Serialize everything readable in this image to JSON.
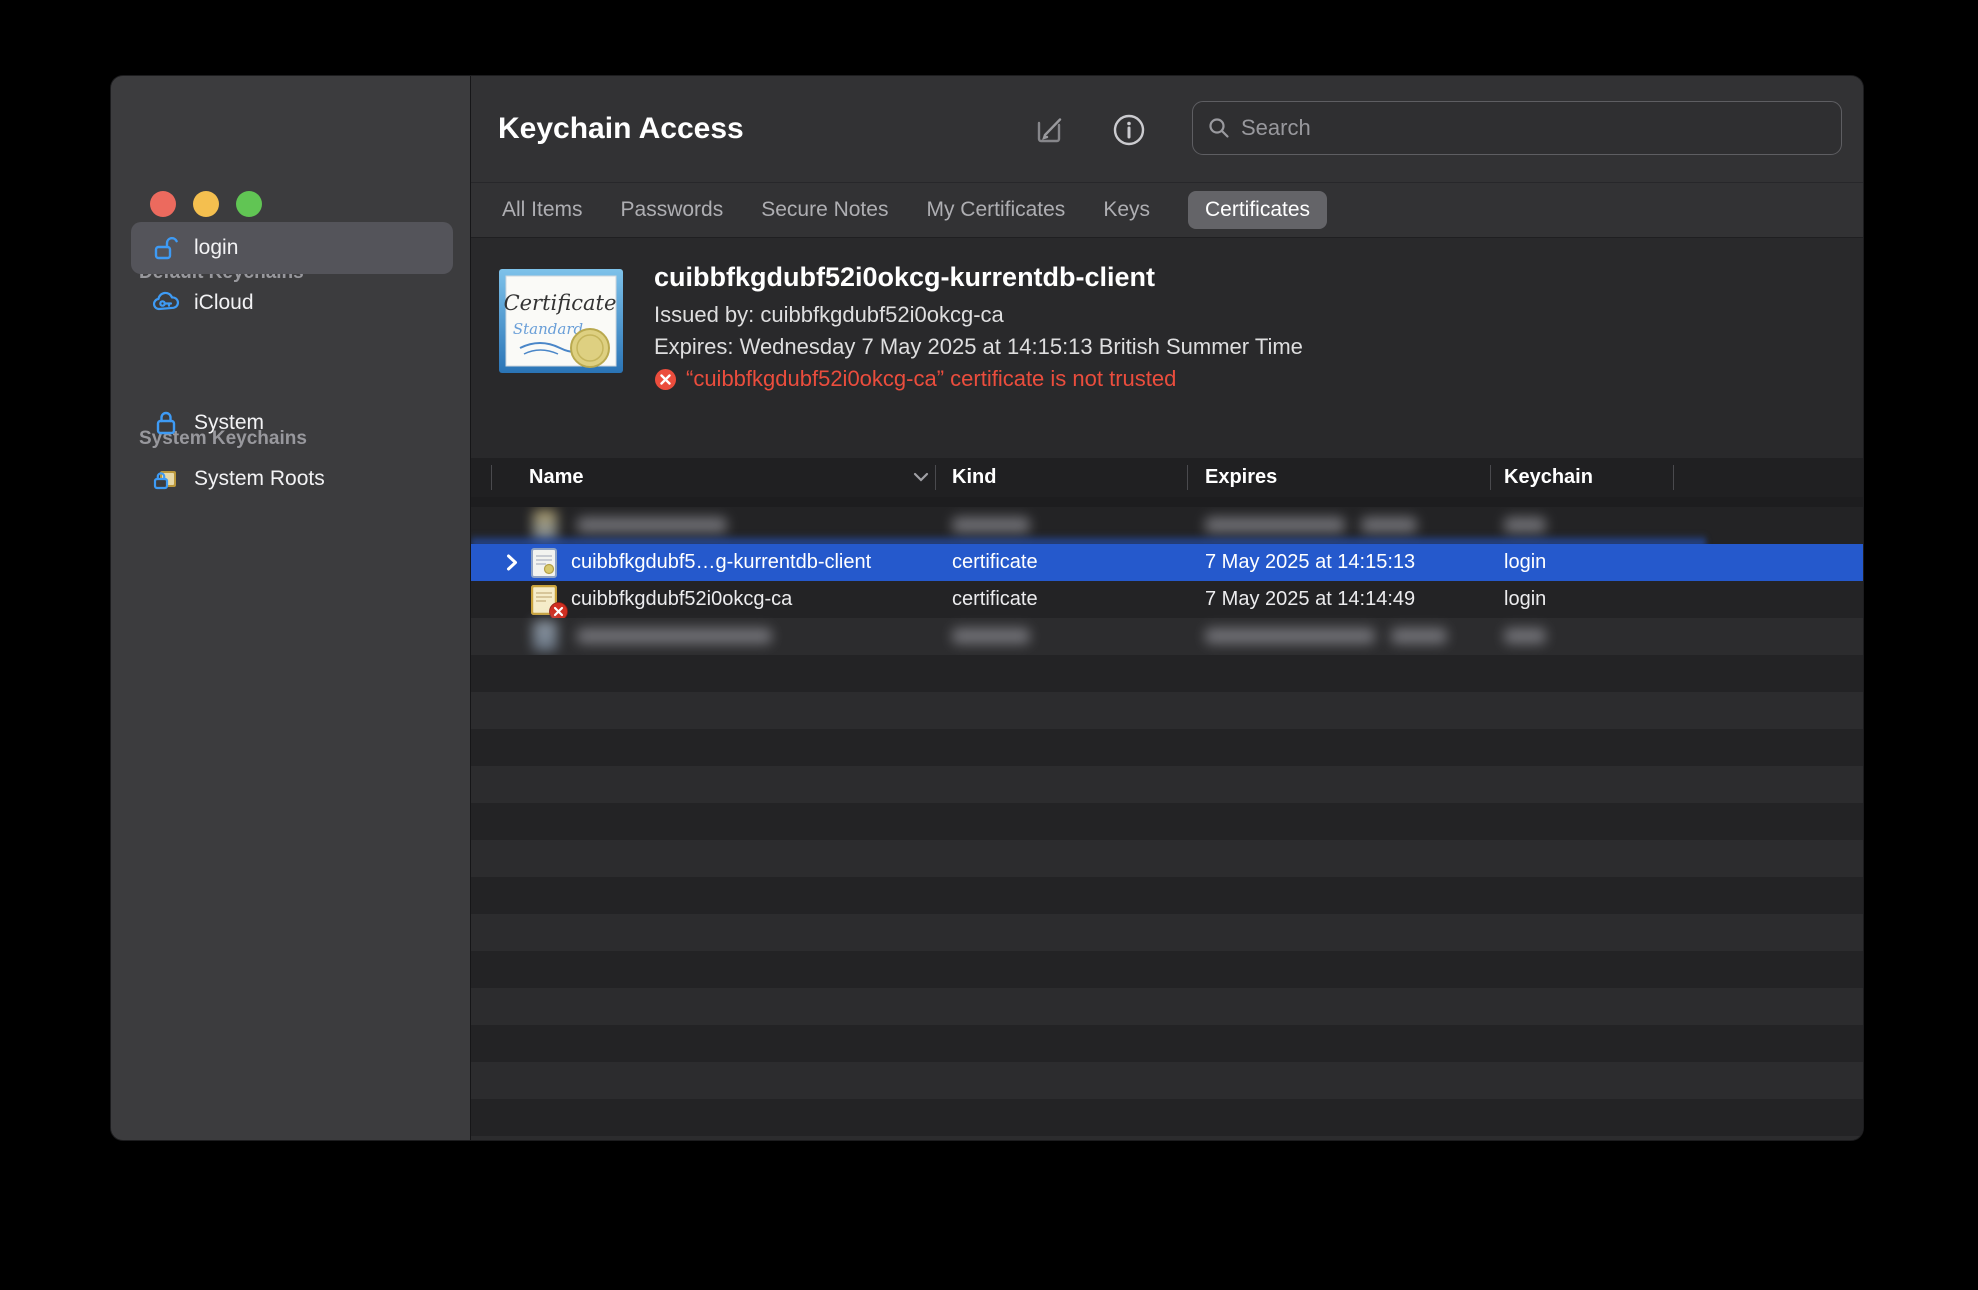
{
  "window_title": "Keychain Access",
  "sidebar": {
    "sections": [
      {
        "label": "Default Keychains",
        "items": [
          {
            "label": "login"
          },
          {
            "label": "iCloud"
          }
        ]
      },
      {
        "label": "System Keychains",
        "items": [
          {
            "label": "System"
          },
          {
            "label": "System Roots"
          }
        ]
      }
    ]
  },
  "toolbar": {
    "search_placeholder": "Search"
  },
  "tabs": {
    "items": [
      {
        "label": "All Items"
      },
      {
        "label": "Passwords"
      },
      {
        "label": "Secure Notes"
      },
      {
        "label": "My Certificates"
      },
      {
        "label": "Keys"
      },
      {
        "label": "Certificates"
      }
    ],
    "selected": "Certificates"
  },
  "detail": {
    "name": "cuibbfkgdubf52i0okcg-kurrentdb-client",
    "issued_by": "Issued by: cuibbfkgdubf52i0okcg-ca",
    "expires": "Expires: Wednesday 7 May 2025 at 14:15:13 British Summer Time",
    "trust_warning": "“cuibbfkgdubf52i0okcg-ca” certificate is not trusted",
    "cert_art_line1": "Certificate",
    "cert_art_line2": "Standard"
  },
  "table": {
    "columns": [
      {
        "label": "Name"
      },
      {
        "label": "Kind"
      },
      {
        "label": "Expires"
      },
      {
        "label": "Keychain"
      }
    ],
    "rows": [
      {
        "redacted": true
      },
      {
        "name": "cuibbfkgdubf5…g-kurrentdb-client",
        "kind": "certificate",
        "expires": "7 May 2025 at 14:15:13",
        "keychain": "login",
        "selected": true
      },
      {
        "name": "cuibbfkgdubf52i0okcg-ca",
        "kind": "certificate",
        "expires": "7 May 2025 at 14:14:49",
        "keychain": "login"
      },
      {
        "redacted": true
      }
    ]
  },
  "colors": {
    "selection_blue": "#2559cc",
    "warning_red": "#eb4d3d",
    "accent_blue": "#3e9bf5",
    "traffic_red": "#ec6a5e",
    "traffic_yellow": "#f4bf4f",
    "traffic_green": "#61c554"
  }
}
